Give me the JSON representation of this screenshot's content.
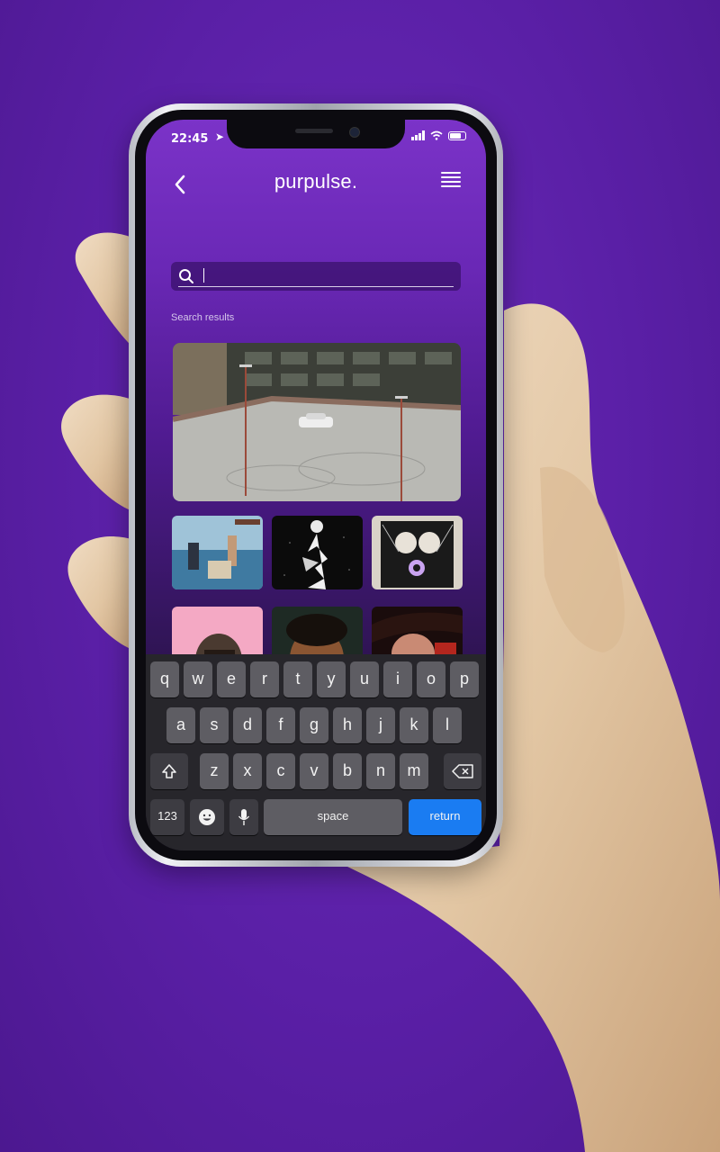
{
  "status_bar": {
    "time": "22:45"
  },
  "header": {
    "title": "purpulse.",
    "back_label": "<"
  },
  "search": {
    "value": "",
    "placeholder": ""
  },
  "results": {
    "label": "Search results"
  },
  "keyboard": {
    "row1": [
      "q",
      "w",
      "e",
      "r",
      "t",
      "y",
      "u",
      "i",
      "o",
      "p"
    ],
    "row2": [
      "a",
      "s",
      "d",
      "f",
      "g",
      "h",
      "j",
      "k",
      "l"
    ],
    "row3": [
      "z",
      "x",
      "c",
      "v",
      "b",
      "n",
      "m"
    ],
    "numbers_label": "123",
    "space_label": "space",
    "return_label": "return"
  },
  "colors": {
    "accent": "#5a1fa6",
    "return_key": "#1a7cf2",
    "background": "#5a1fa6"
  }
}
